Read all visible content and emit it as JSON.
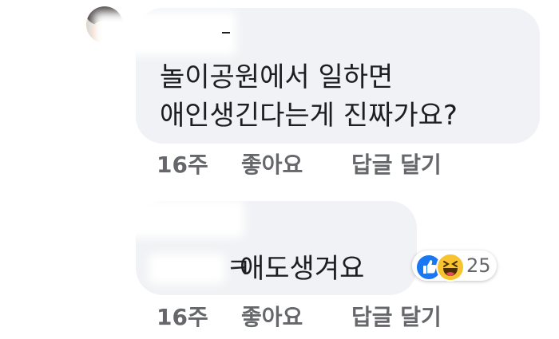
{
  "comment1": {
    "line1": "놀이공원에서 일하면",
    "line2": "애인생긴다는게 진짜가요?",
    "time": "16주",
    "like_label": "좋아요",
    "reply_label": "답글 달기"
  },
  "comment2": {
    "text": "애도생겨요",
    "fragment": "ㅋ",
    "time": "16주",
    "like_label": "좋아요",
    "reply_label": "답글 달기",
    "reaction_count": "25",
    "reaction_icons": [
      "like-icon",
      "haha-icon"
    ]
  },
  "colors": {
    "bubble": "#f0f2f5",
    "text": "#1c1e21",
    "muted": "#65676b",
    "like_blue": "#1877f2",
    "haha_yellow": "#f7c331"
  }
}
